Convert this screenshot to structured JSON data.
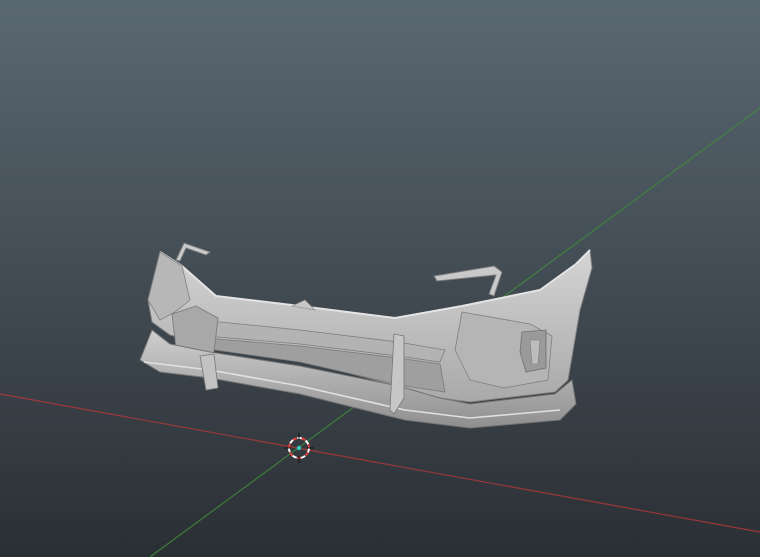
{
  "app": {
    "view": "3D viewport",
    "shading": "solid"
  },
  "colors": {
    "background_top": "#5a6872",
    "background_bottom": "#2a2f34",
    "x_axis": "#b03838",
    "y_axis": "#3f8a3a",
    "model_base": "#bdbdbd",
    "model_light": "#d6d6d6",
    "model_shadow": "#8e8e8e",
    "cursor_ring_a": "#e04040",
    "cursor_ring_b": "#ffffff",
    "cursor_dot": "#30c8c0"
  },
  "scene": {
    "object_name": "front-bumper",
    "cursor": "3d-cursor",
    "origin": "world-origin"
  }
}
